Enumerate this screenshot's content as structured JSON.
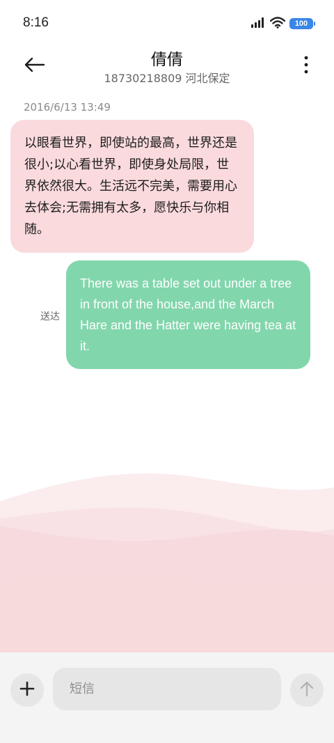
{
  "status_bar": {
    "time": "8:16",
    "battery": "100",
    "icons": [
      "signal-icon",
      "wifi-icon",
      "battery-icon"
    ]
  },
  "header": {
    "contact_name": "倩倩",
    "contact_sub": "18730218809 河北保定",
    "back_icon": "arrow-left-icon",
    "more_icon": "more-vertical-icon"
  },
  "conversation": {
    "timestamp": "2016/6/13 13:49",
    "incoming": {
      "text": "以眼看世界，即使站的最高，世界还是很小;以心看世界，即使身处局限，世界依然很大。生活远不完美，需要用心去体会;无需拥有太多，愿快乐与你相随。"
    },
    "outgoing": {
      "text": "There was a table set out under a tree in front of the house,and the March Hare and the Hatter were having tea at it.",
      "status": "送达"
    }
  },
  "composer": {
    "placeholder": "短信",
    "add_icon": "plus-icon",
    "send_icon": "arrow-up-icon"
  },
  "colors": {
    "incoming_bubble": "#fadadd",
    "outgoing_bubble": "#82d6ac",
    "wave": "#f6d8dc"
  }
}
